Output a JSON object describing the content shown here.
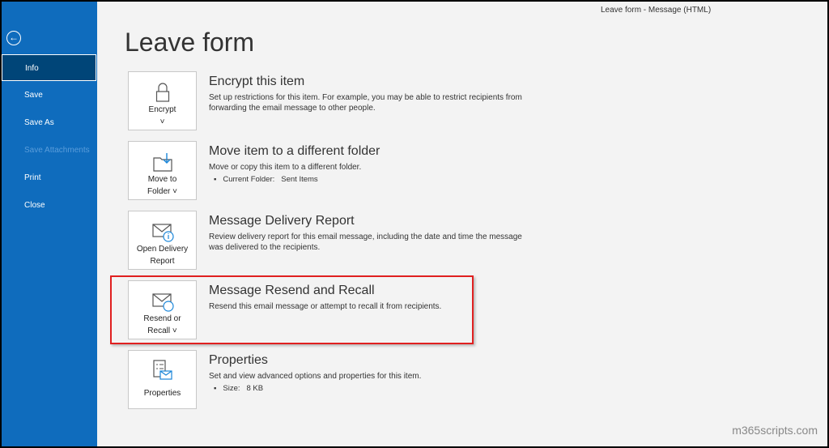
{
  "window_title": "Leave form  -  Message (HTML)",
  "page_title": "Leave form",
  "sidebar": {
    "items": [
      {
        "label": "Info",
        "selected": true
      },
      {
        "label": "Save"
      },
      {
        "label": "Save As"
      },
      {
        "label": "Save Attachments",
        "disabled": true
      },
      {
        "label": "Print"
      },
      {
        "label": "Close"
      }
    ]
  },
  "sections": [
    {
      "button_l1": "Encrypt",
      "button_l2": "˅",
      "icon": "lock-icon",
      "title": "Encrypt this item",
      "desc": "Set up restrictions for this item. For example, you may be able to restrict recipients from forwarding the email message to other people."
    },
    {
      "button_l1": "Move to",
      "button_l2": "Folder ˅",
      "icon": "folder-move-icon",
      "title": "Move item to a different folder",
      "desc": "Move or copy this item to a different folder.",
      "bullet_label": "Current Folder:",
      "bullet_value": "Sent Items"
    },
    {
      "button_l1": "Open Delivery",
      "button_l2": "Report",
      "icon": "envelope-info-icon",
      "title": "Message Delivery Report",
      "desc": "Review delivery report for this email message, including the date and time the message was delivered to the recipients."
    },
    {
      "button_l1": "Resend or",
      "button_l2": "Recall ˅",
      "icon": "envelope-refresh-icon",
      "title": "Message Resend and Recall",
      "desc": "Resend this email message or attempt to recall it from recipients."
    },
    {
      "button_l1": "Properties",
      "button_l2": "",
      "icon": "properties-icon",
      "title": "Properties",
      "desc": "Set and view advanced options and properties for this item.",
      "bullet_label": "Size:",
      "bullet_value": "8 KB"
    }
  ],
  "watermark": "m365scripts.com",
  "colors": {
    "sidebar": "#0f6cbd",
    "selected": "#004578",
    "highlight": "#e02020"
  }
}
